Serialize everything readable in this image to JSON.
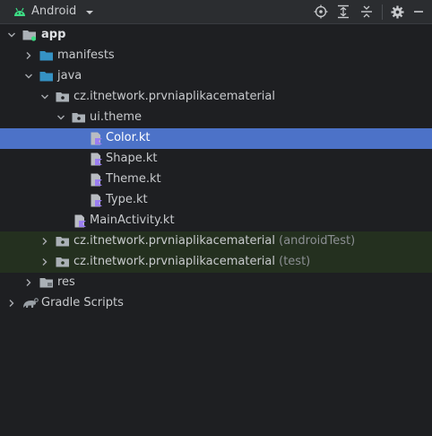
{
  "toolbar": {
    "view_label": "Android",
    "icons": [
      "android-icon",
      "chevron-down-icon",
      "locate-icon",
      "expand-all-icon",
      "collapse-all-icon",
      "settings-icon",
      "hide-icon"
    ]
  },
  "tree": {
    "items": [
      {
        "label": "app",
        "icon": "module-folder-icon",
        "expanded": true
      },
      {
        "label": "manifests",
        "icon": "folder-icon",
        "expanded": false
      },
      {
        "label": "java",
        "icon": "folder-icon",
        "expanded": true
      },
      {
        "label": "cz.itnetwork.prvniaplikacematerial",
        "icon": "package-icon",
        "expanded": true
      },
      {
        "label": "ui.theme",
        "icon": "package-icon",
        "expanded": true
      },
      {
        "label": "Color.kt",
        "icon": "kotlin-file-icon",
        "selected": true
      },
      {
        "label": "Shape.kt",
        "icon": "kotlin-file-icon"
      },
      {
        "label": "Theme.kt",
        "icon": "kotlin-file-icon"
      },
      {
        "label": "Type.kt",
        "icon": "kotlin-file-icon"
      },
      {
        "label": "MainActivity.kt",
        "icon": "kotlin-file-icon"
      },
      {
        "label": "cz.itnetwork.prvniaplikacematerial",
        "suffix": "(androidTest)",
        "icon": "package-icon",
        "expanded": false
      },
      {
        "label": "cz.itnetwork.prvniaplikacematerial",
        "suffix": "(test)",
        "icon": "package-icon",
        "expanded": false
      },
      {
        "label": "res",
        "icon": "folder-icon",
        "expanded": false
      },
      {
        "label": "Gradle Scripts",
        "icon": "gradle-icon",
        "expanded": false
      }
    ]
  },
  "colors": {
    "background": "#1e1f22",
    "toolbar": "#2b2d30",
    "selection": "#4c72c8",
    "test_highlight": "#24301f",
    "folder_blue": "#3592c4",
    "android_green": "#3ddc84",
    "kotlin_purple": "#9b7ef2"
  }
}
